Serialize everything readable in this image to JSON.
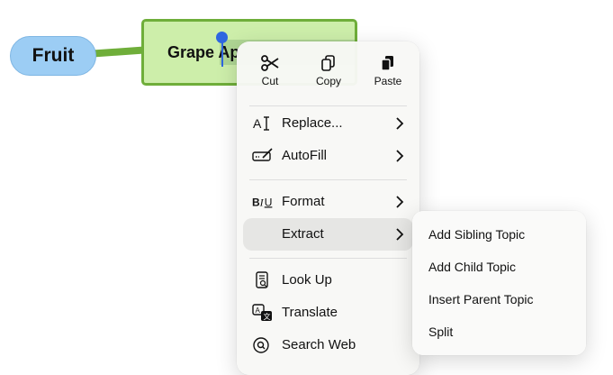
{
  "mindmap": {
    "root_label": "Fruit",
    "child_label": "Grape Ap"
  },
  "menu": {
    "actions": [
      {
        "label": "Cut",
        "icon": "scissors-icon"
      },
      {
        "label": "Copy",
        "icon": "copy-icon"
      },
      {
        "label": "Paste",
        "icon": "paste-icon"
      }
    ],
    "items": {
      "replace": "Replace...",
      "autofill": "AutoFill",
      "format": "Format",
      "extract": "Extract",
      "lookup": "Look Up",
      "translate": "Translate",
      "search_web": "Search Web"
    }
  },
  "submenu": {
    "items": [
      "Add Sibling Topic",
      "Add Child Topic",
      "Insert Parent Topic",
      "Split"
    ]
  },
  "colors": {
    "root_fill": "#9ccdf4",
    "child_fill": "#cdeeaa",
    "child_border": "#6fae3a",
    "caret": "#2f66e0"
  }
}
